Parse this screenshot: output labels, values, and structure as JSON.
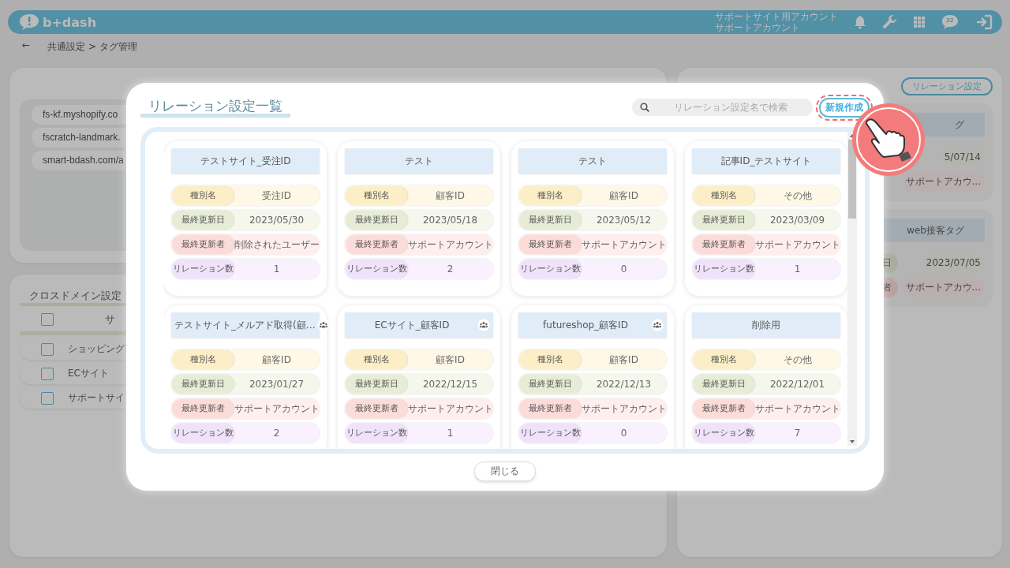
{
  "header": {
    "logo": "b+dash",
    "account_lines": [
      "サポートサイト用アカウント",
      "サポートアカウント"
    ],
    "chat_badge": "32"
  },
  "breadcrumb": {
    "back": "←",
    "path": "共通設定 > タグ管理"
  },
  "domains_panel": {
    "items": [
      "fs-kf.myshopify.co",
      "fscratch-landmark.",
      "smart-bdash.com/a"
    ]
  },
  "cross_domain_panel": {
    "title": "クロスドメイン設定",
    "header_checked": false,
    "column_1": "サ",
    "rows": [
      {
        "label": "ショッピング",
        "checked": false
      },
      {
        "label": "ECサイト",
        "checked": false
      },
      {
        "label": "サポートサイ",
        "checked": false
      }
    ]
  },
  "relation_panel": {
    "button": "リレーション設定",
    "cards": [
      {
        "title": "グ",
        "fields": [
          {
            "kind": "date",
            "value": "5/07/14"
          },
          {
            "kind": "user",
            "value": "サポートアカウ..."
          }
        ]
      },
      {
        "title": "web接客タグ",
        "fields": [
          {
            "kind": "date",
            "label": "日",
            "value": "2023/07/05"
          },
          {
            "kind": "user",
            "label": "者",
            "value": "サポートアカウ..."
          }
        ]
      }
    ]
  },
  "modal": {
    "title": "リレーション設定一覧",
    "search": {
      "placeholder": "リレーション設定名で検索"
    },
    "new_button": "新規作成",
    "new_button_highlighted": true,
    "cards": [
      {
        "title": "テストサイト_受注ID",
        "shared": false,
        "fields": [
          {
            "kind": "type",
            "label": "種別名",
            "value": "受注ID"
          },
          {
            "kind": "date",
            "label": "最終更新日",
            "value": "2023/05/30"
          },
          {
            "kind": "user",
            "label": "最終更新者",
            "value": "削除されたユーザー"
          },
          {
            "kind": "count",
            "label": "リレーション数",
            "value": "1"
          }
        ]
      },
      {
        "title": "テスト",
        "shared": false,
        "fields": [
          {
            "kind": "type",
            "label": "種別名",
            "value": "顧客ID"
          },
          {
            "kind": "date",
            "label": "最終更新日",
            "value": "2023/05/18"
          },
          {
            "kind": "user",
            "label": "最終更新者",
            "value": "サポートアカウント"
          },
          {
            "kind": "count",
            "label": "リレーション数",
            "value": "2"
          }
        ]
      },
      {
        "title": "テスト",
        "shared": false,
        "fields": [
          {
            "kind": "type",
            "label": "種別名",
            "value": "顧客ID"
          },
          {
            "kind": "date",
            "label": "最終更新日",
            "value": "2023/05/12"
          },
          {
            "kind": "user",
            "label": "最終更新者",
            "value": "サポートアカウント"
          },
          {
            "kind": "count",
            "label": "リレーション数",
            "value": "0"
          }
        ]
      },
      {
        "title": "記事ID_テストサイト",
        "shared": false,
        "fields": [
          {
            "kind": "type",
            "label": "種別名",
            "value": "その他"
          },
          {
            "kind": "date",
            "label": "最終更新日",
            "value": "2023/03/09"
          },
          {
            "kind": "user",
            "label": "最終更新者",
            "value": "サポートアカウント"
          },
          {
            "kind": "count",
            "label": "リレーション数",
            "value": "1"
          }
        ]
      },
      {
        "title": "テストサイト_メルアド取得(顧…",
        "shared": true,
        "fields": [
          {
            "kind": "type",
            "label": "種別名",
            "value": "顧客ID"
          },
          {
            "kind": "date",
            "label": "最終更新日",
            "value": "2023/01/27"
          },
          {
            "kind": "user",
            "label": "最終更新者",
            "value": "サポートアカウント"
          },
          {
            "kind": "count",
            "label": "リレーション数",
            "value": "2"
          }
        ]
      },
      {
        "title": "ECサイト_顧客ID",
        "shared": true,
        "fields": [
          {
            "kind": "type",
            "label": "種別名",
            "value": "顧客ID"
          },
          {
            "kind": "date",
            "label": "最終更新日",
            "value": "2022/12/15"
          },
          {
            "kind": "user",
            "label": "最終更新者",
            "value": "サポートアカウント"
          },
          {
            "kind": "count",
            "label": "リレーション数",
            "value": "1"
          }
        ]
      },
      {
        "title": "futureshop_顧客ID",
        "shared": true,
        "fields": [
          {
            "kind": "type",
            "label": "種別名",
            "value": "顧客ID"
          },
          {
            "kind": "date",
            "label": "最終更新日",
            "value": "2022/12/13"
          },
          {
            "kind": "user",
            "label": "最終更新者",
            "value": "サポートアカウント"
          },
          {
            "kind": "count",
            "label": "リレーション数",
            "value": "0"
          }
        ]
      },
      {
        "title": "削除用",
        "shared": false,
        "fields": [
          {
            "kind": "type",
            "label": "種別名",
            "value": "その他"
          },
          {
            "kind": "date",
            "label": "最終更新日",
            "value": "2022/12/01"
          },
          {
            "kind": "user",
            "label": "最終更新者",
            "value": "サポートアカウント"
          },
          {
            "kind": "count",
            "label": "リレーション数",
            "value": "7"
          }
        ]
      }
    ],
    "close_button": "閉じる"
  }
}
